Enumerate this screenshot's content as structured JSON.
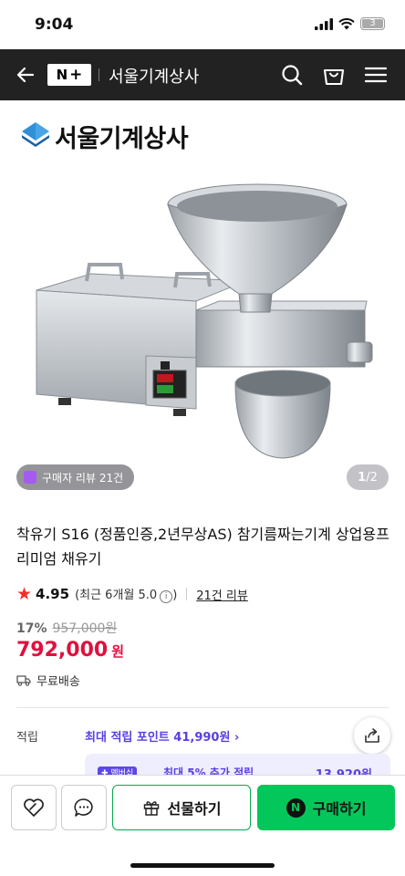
{
  "status_bar": {
    "time": "9:04",
    "battery": "3"
  },
  "nav": {
    "logo_n": "N",
    "logo_plus": "+",
    "store_name": "서울기계상사"
  },
  "store": {
    "name": "서울기계상사"
  },
  "gallery": {
    "review_badge": "구매자 리뷰 21건",
    "page_current": "1",
    "page_total": "/2"
  },
  "product": {
    "title": "착유기 S16 (정품인증,2년무상AS) 참기름짜는기계 상업용프리미엄 채유기",
    "rating": "4.95",
    "rating_recent": "(최근 6개월 5.0",
    "rating_recent_close": ")",
    "info_glyph": "i",
    "review_count_link": "21건 리뷰",
    "discount": "17%",
    "original_price": "957,000원",
    "price": "792,000",
    "price_unit": "원",
    "shipping": "무료배송"
  },
  "points": {
    "label": "적립",
    "max_points": "최대 적립 포인트 41,990원 ›",
    "promo_tag": "✚ 멤버십",
    "promo_text": "최대 5% 추가 적립",
    "promo_amount": "13,920원"
  },
  "bottom_bar": {
    "gift_label": "선물하기",
    "buy_label": "구매하기",
    "n_badge": "N"
  },
  "colors": {
    "brand_green": "#03c75a",
    "price_red": "#e0103f",
    "points_purple": "#5a3fe0",
    "nav_dark": "#222222"
  },
  "icons": [
    "back-arrow-icon",
    "search-icon",
    "shopping-bag-icon",
    "menu-icon",
    "star-icon",
    "truck-icon",
    "share-icon",
    "heart-icon",
    "chat-icon",
    "gift-icon"
  ]
}
